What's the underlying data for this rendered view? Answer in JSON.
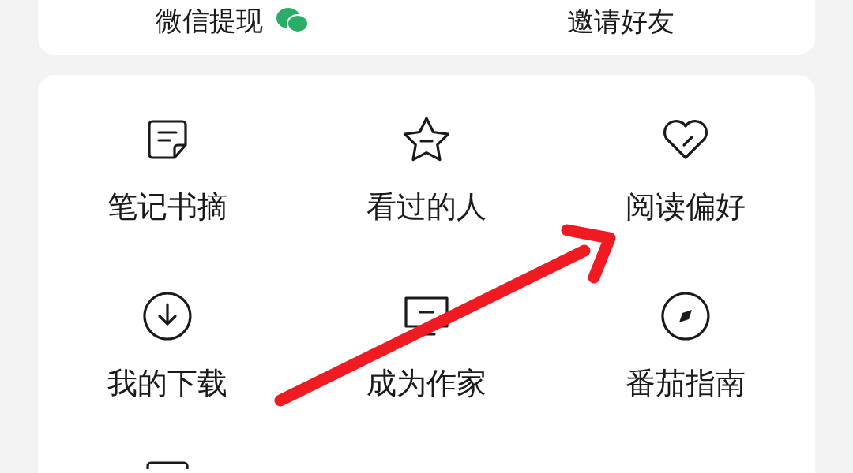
{
  "top_card": {
    "items": [
      {
        "label": "微信提现",
        "kind": "wechat"
      },
      {
        "label": "邀请好友",
        "kind": "plain"
      }
    ]
  },
  "menu_grid": {
    "items": [
      {
        "label": "笔记书摘",
        "kind": "note"
      },
      {
        "label": "看过的人",
        "kind": "star"
      },
      {
        "label": "阅读偏好",
        "kind": "heart"
      },
      {
        "label": "我的下载",
        "kind": "download"
      },
      {
        "label": "成为作家",
        "kind": "monitor"
      },
      {
        "label": "番茄指南",
        "kind": "compass"
      }
    ]
  }
}
